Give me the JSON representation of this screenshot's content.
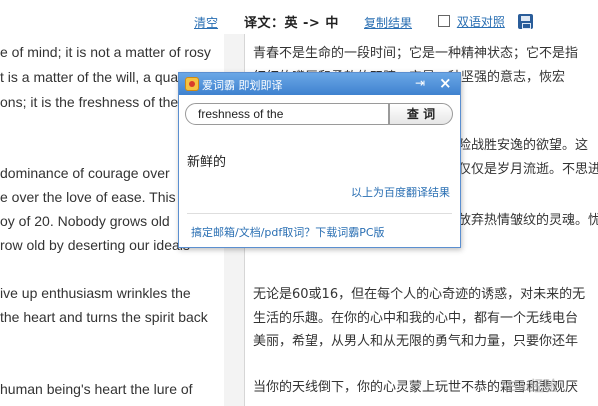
{
  "toolbar": {
    "clear_label": "清空",
    "title": "译文：英 -> 中",
    "copy_label": "复制结果",
    "compare_label": "双语对照",
    "compare_checked": false,
    "save_icon": "save-icon"
  },
  "left_panel": {
    "lines": [
      "e of mind; it is not a matter of rosy",
      "t is a matter of the will, a qua",
      "ons; it is the freshness of the",
      "",
      "dominance of courage over",
      "e over the love of ease. This o",
      "oy of 20. Nobody grows old",
      "row old by deserting our ideals",
      "",
      "ive up enthusiasm wrinkles the",
      " the heart and turns the spirit back",
      "",
      "human being's heart the lure of"
    ]
  },
  "right_panel": {
    "lines": [
      "青春不是生命的一段时间；它是一种精神状态；它不是指",
      "红红的嘴唇和柔软的双膝；它是一种坚强的意志，恢宏",
      "",
      "",
      "险战胜安逸的欲望。这",
      "仅仅是岁月流逝。不思进",
      "",
      "放弃热情皱纹的灵魂。忧",
      "",
      "",
      "无论是60或16，但在每个人的心奇迹的诱惑，对未来的无",
      "生活的乐趣。在你的心中和我的心中，都有一个无线电台",
      "美丽，希望，从男人和从无限的勇气和力量，只要你还年",
      "",
      "当你的天线倒下，你的心灵蒙上玩世不恭的霜雪和悲观厌"
    ]
  },
  "popup": {
    "title": "爱词霸 即划即译",
    "query": "freshness of the",
    "search_label": "查 词",
    "result": "新鲜的",
    "source_note": "以上为百度翻译结果",
    "footer_link": "搞定邮箱/文档/pdf取词？下载词霸PC版"
  },
  "watermark": "Bai经验"
}
